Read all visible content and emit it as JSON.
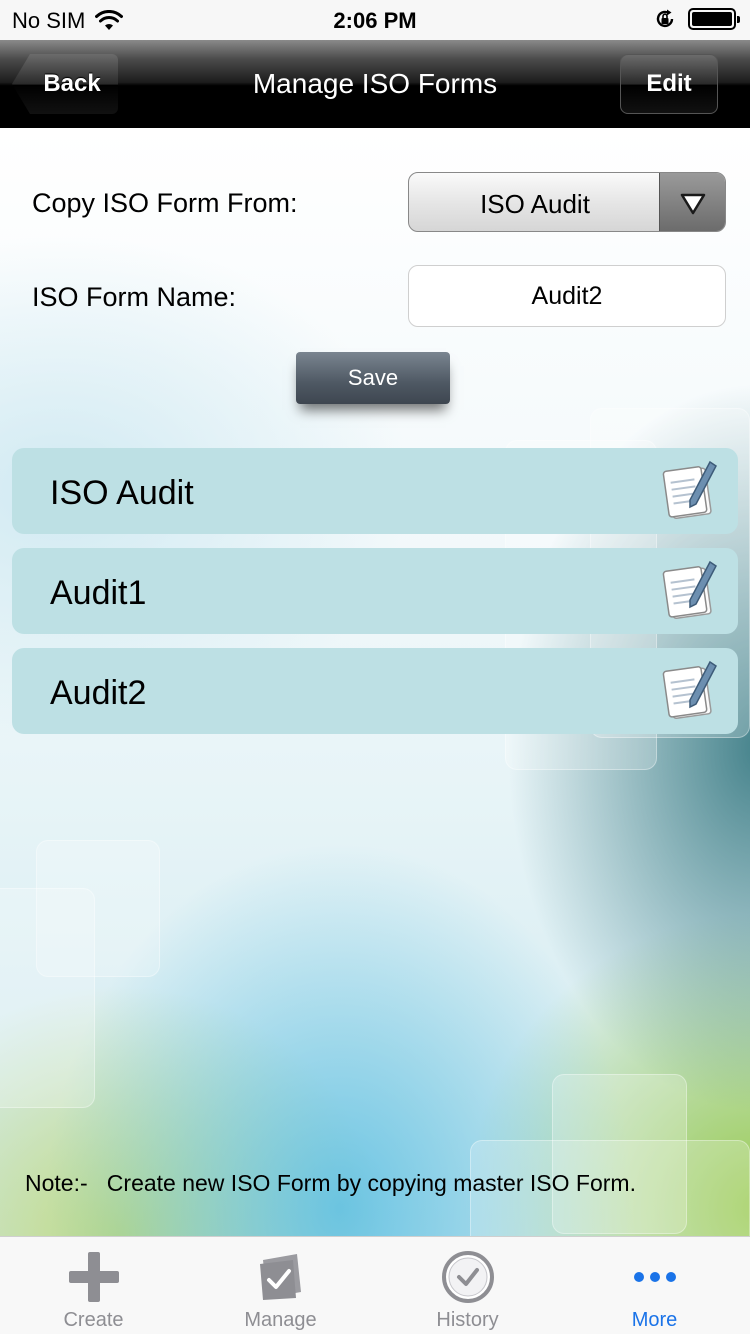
{
  "status_bar": {
    "carrier": "No SIM",
    "time": "2:06 PM"
  },
  "nav": {
    "title": "Manage ISO Forms",
    "back_label": "Back",
    "edit_label": "Edit"
  },
  "form": {
    "copy_label": "Copy ISO Form From:",
    "copy_value": "ISO Audit",
    "name_label": "ISO Form Name:",
    "name_value": "Audit2",
    "save_label": "Save"
  },
  "forms_list": [
    {
      "name": "ISO Audit",
      "icon": "edit-note-icon"
    },
    {
      "name": "Audit1",
      "icon": "edit-note-icon"
    },
    {
      "name": "Audit2",
      "icon": "edit-note-icon"
    }
  ],
  "note": "Note:-   Create new ISO Form by copying master ISO Form.",
  "tabs": [
    {
      "label": "Create",
      "icon": "plus-icon"
    },
    {
      "label": "Manage",
      "icon": "folder-check-icon"
    },
    {
      "label": "History",
      "icon": "clock-icon"
    },
    {
      "label": "More",
      "icon": "more-dots-icon",
      "active": true
    }
  ],
  "colors": {
    "accent": "#1a73e8",
    "list_bg": "#bde0e4",
    "nav_bg": "#000000"
  }
}
